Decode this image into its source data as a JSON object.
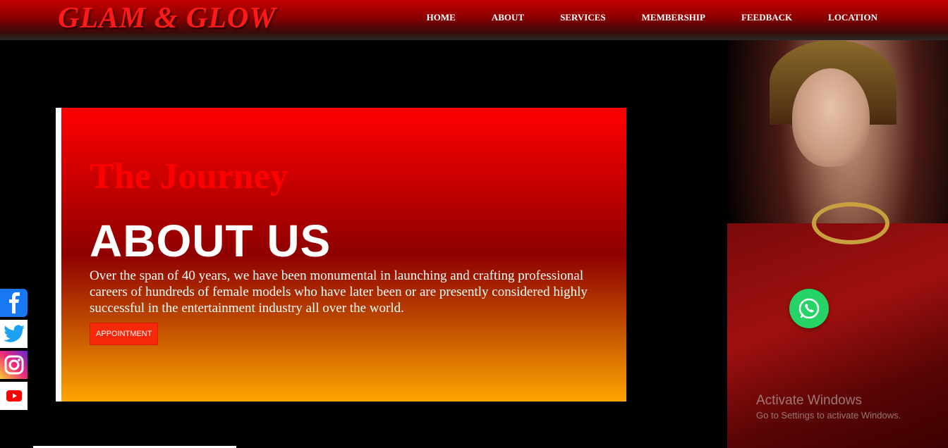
{
  "brand": {
    "logo": "GLAM & GLOW"
  },
  "nav": {
    "items": [
      "HOME",
      "ABOUT",
      "SERVICES",
      "MEMBERSHIP",
      "FEEDBACK",
      "LOCATION"
    ]
  },
  "hero": {
    "kicker": "The Journey",
    "title": "ABOUT US",
    "body": "Over the span of 40 years, we have been monumental in launching and crafting professional careers of hundreds of female models who have later been or are presently considered highly successful in the entertainment industry all over the world.",
    "button_label": "APPOINTMENT"
  },
  "social": {
    "items": [
      {
        "icon": "facebook-icon"
      },
      {
        "icon": "twitter-icon"
      },
      {
        "icon": "instagram-icon"
      },
      {
        "icon": "youtube-icon"
      }
    ]
  },
  "watermark": {
    "line1": "Activate Windows",
    "line2": "Go to Settings to activate Windows."
  },
  "colors": {
    "accent_red": "#ff0000",
    "button": "#f5280a",
    "whatsapp": "#25d366"
  }
}
